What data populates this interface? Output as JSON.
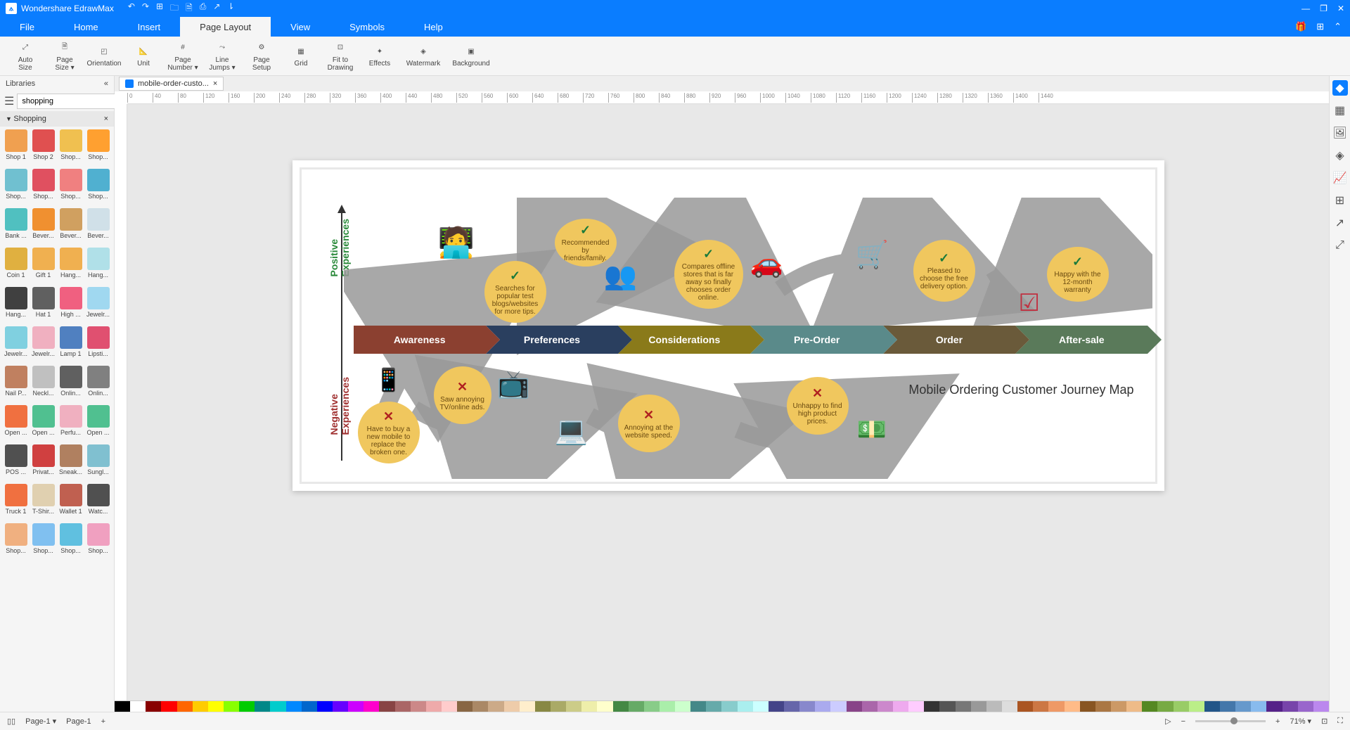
{
  "app": {
    "title": "Wondershare EdrawMax"
  },
  "menu": {
    "file": "File",
    "home": "Home",
    "insert": "Insert",
    "page_layout": "Page Layout",
    "view": "View",
    "symbols": "Symbols",
    "help": "Help"
  },
  "ribbon": {
    "auto_size": "Auto\nSize",
    "page_size": "Page\nSize ▾",
    "orientation": "Orientation",
    "unit": "Unit",
    "page_number": "Page\nNumber ▾",
    "line_jumps": "Line\nJumps ▾",
    "page_setup": "Page\nSetup",
    "grid": "Grid",
    "fit_to_drawing": "Fit to\nDrawing",
    "effects": "Effects",
    "watermark": "Watermark",
    "background": "Background"
  },
  "libraries": {
    "title": "Libraries",
    "search_value": "shopping",
    "category": "Shopping",
    "items": [
      "Shop 1",
      "Shop 2",
      "Shop...",
      "Shop...",
      "Shop...",
      "Shop...",
      "Shop...",
      "Shop...",
      "Bank ...",
      "Bever...",
      "Bever...",
      "Bever...",
      "Coin 1",
      "Gift 1",
      "Hang...",
      "Hang...",
      "Hang...",
      "Hat 1",
      "High ...",
      "Jewelr...",
      "Jewelr...",
      "Jewelr...",
      "Lamp 1",
      "Lipsti...",
      "Nail P...",
      "Neckl...",
      "Onlin...",
      "Onlin...",
      "Open ...",
      "Open ...",
      "Perfu...",
      "Open ...",
      "POS ...",
      "Privat...",
      "Sneak...",
      "Sungl...",
      "Truck 1",
      "T-Shir...",
      "Wallet 1",
      "Watc...",
      "Shop...",
      "Shop...",
      "Shop...",
      "Shop..."
    ],
    "thumb_colors": [
      "#f0a050",
      "#e05050",
      "#f0c050",
      "#ffa030",
      "#70c0d0",
      "#e05060",
      "#f08080",
      "#50b0d0",
      "#50c0c0",
      "#f09030",
      "#d0a060",
      "#d0e0e8",
      "#e0b040",
      "#f0b050",
      "#f0b050",
      "#b0e0e8",
      "#404040",
      "#606060",
      "#f06080",
      "#a0d8f0",
      "#80d0e0",
      "#f0b0c0",
      "#5080c0",
      "#e05070",
      "#c08060",
      "#c0c0c0",
      "#606060",
      "#808080",
      "#f07040",
      "#50c090",
      "#f0b0c0",
      "#50c090",
      "#505050",
      "#d04040",
      "#b08060",
      "#80c0d0",
      "#f07040",
      "#e0d0b0",
      "#c06050",
      "#505050",
      "#f0b080",
      "#80c0f0",
      "#60c0e0",
      "#f0a0c0"
    ]
  },
  "tab": {
    "name": "mobile-order-custo..."
  },
  "ruler_marks": [
    "0",
    "40",
    "80",
    "120",
    "160",
    "200",
    "240",
    "280",
    "320",
    "360",
    "400",
    "440",
    "480",
    "520",
    "560",
    "600",
    "640",
    "680",
    "720",
    "760",
    "800",
    "840",
    "880",
    "920",
    "960",
    "1000",
    "1040",
    "1080",
    "1120",
    "1160",
    "1200",
    "1240",
    "1280",
    "1320",
    "1360",
    "1400",
    "1440"
  ],
  "diagram": {
    "title": "Mobile Ordering Customer Journey Map",
    "axis_positive": "Positive\nExperiences",
    "axis_negative": "Negative\nExperiences",
    "stages": [
      "Awareness",
      "Preferences",
      "Considerations",
      "Pre-Order",
      "Order",
      "After-sale"
    ],
    "positive_bubbles": [
      {
        "text": "Searches for popular test blogs/websites for more tips."
      },
      {
        "text": "Recommended by friends/family."
      },
      {
        "text": "Compares offline stores that is far away so finally chooses order online."
      },
      {
        "text": "Pleased to choose the free delivery option."
      },
      {
        "text": "Happy with the 12-month warranty"
      }
    ],
    "negative_bubbles": [
      {
        "text": "Have to buy a new mobile to replace the broken one."
      },
      {
        "text": "Saw annoying TV/online ads."
      },
      {
        "text": "Annoying at the website speed."
      },
      {
        "text": "Unhappy to find high product prices."
      }
    ]
  },
  "status": {
    "page_select": "Page-1",
    "page_tab": "Page-1",
    "zoom": "71%"
  },
  "palette_colors": [
    "#000",
    "#fff",
    "#800",
    "#f00",
    "#f60",
    "#fc0",
    "#ff0",
    "#8f0",
    "#0c0",
    "#088",
    "#0cc",
    "#08f",
    "#06c",
    "#00f",
    "#60f",
    "#c0f",
    "#f0c",
    "#844",
    "#a66",
    "#c88",
    "#eaa",
    "#fcc",
    "#864",
    "#a86",
    "#ca8",
    "#eca",
    "#fec",
    "#884",
    "#aa6",
    "#cc8",
    "#eea",
    "#ffc",
    "#484",
    "#6a6",
    "#8c8",
    "#aea",
    "#cfc",
    "#488",
    "#6aa",
    "#8cc",
    "#aee",
    "#cff",
    "#448",
    "#66a",
    "#88c",
    "#aae",
    "#ccf",
    "#848",
    "#a6a",
    "#c8c",
    "#eae",
    "#fcf",
    "#333",
    "#555",
    "#777",
    "#999",
    "#bbb",
    "#ddd",
    "#a52",
    "#c74",
    "#e96",
    "#fb8",
    "#852",
    "#a74",
    "#c96",
    "#eb8",
    "#582",
    "#7a4",
    "#9c6",
    "#be8",
    "#258",
    "#47a",
    "#69c",
    "#8be",
    "#528",
    "#74a",
    "#96c",
    "#b8e"
  ]
}
